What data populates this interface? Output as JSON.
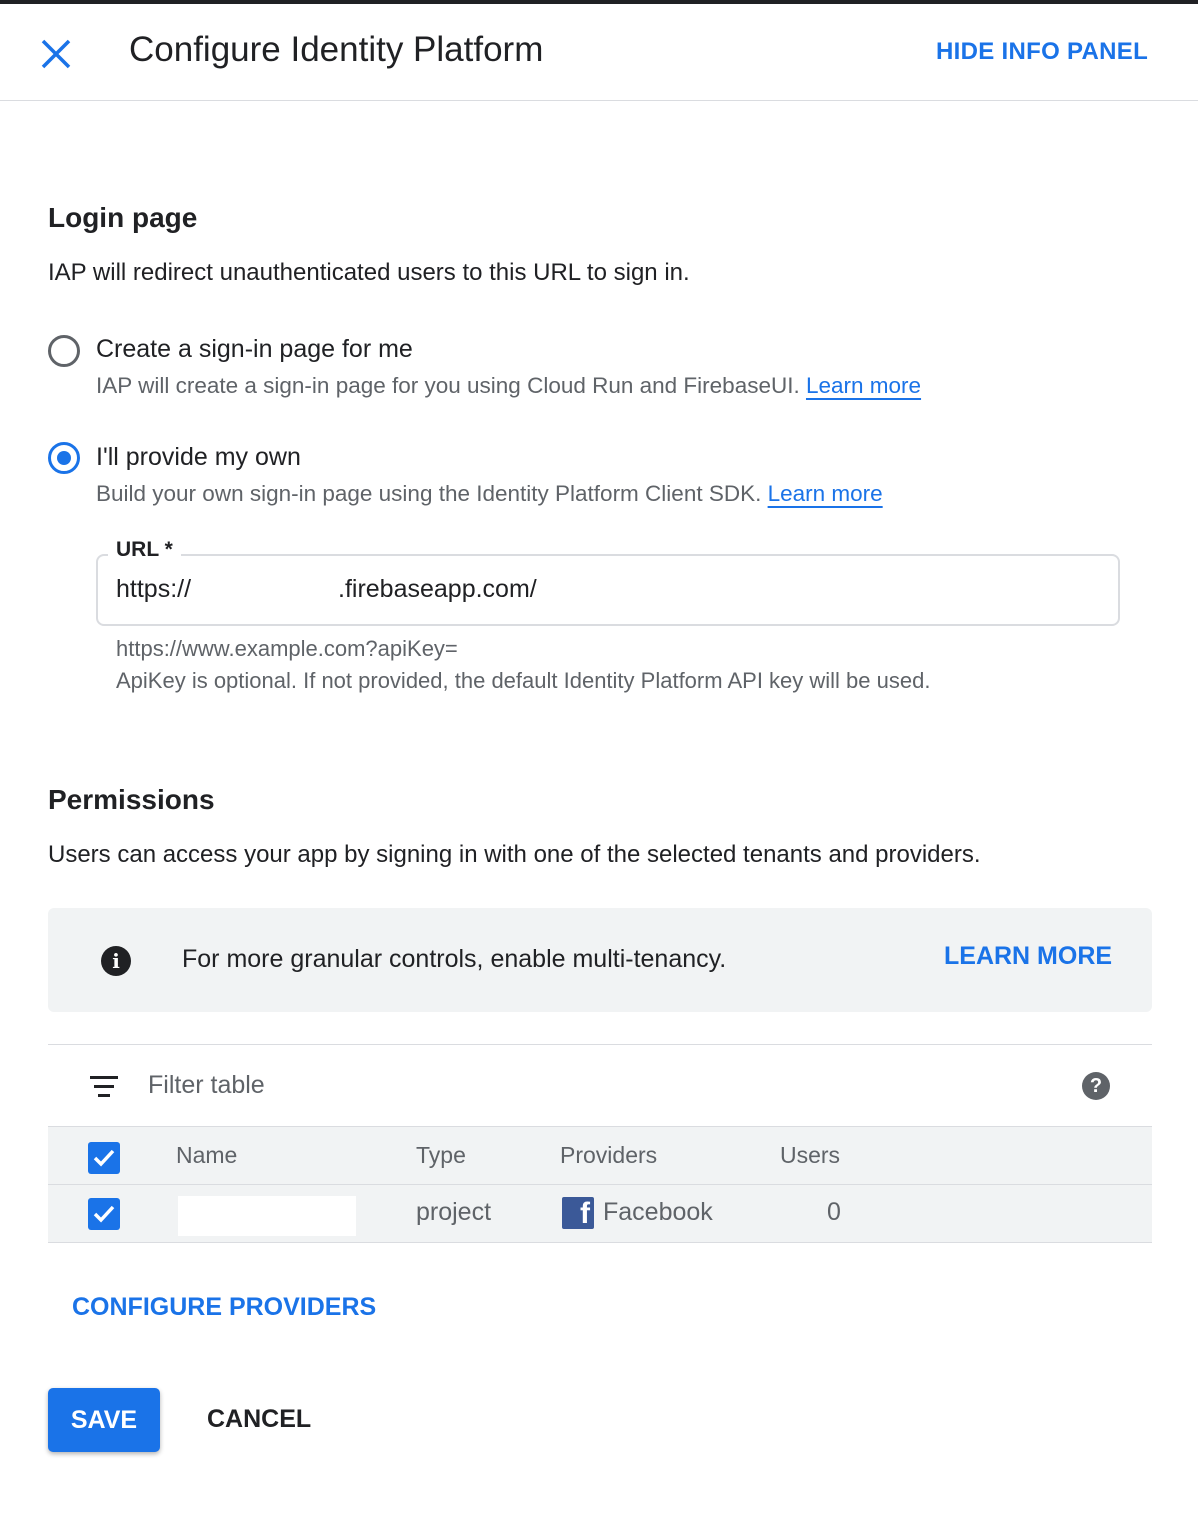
{
  "header": {
    "title": "Configure Identity Platform",
    "hide_panel_label": "HIDE INFO PANEL"
  },
  "login": {
    "heading": "Login page",
    "description": "IAP will redirect unauthenticated users to this URL to sign in.",
    "options": [
      {
        "label": "Create a sign-in page for me",
        "description": "IAP will create a sign-in page for you using Cloud Run and FirebaseUI.",
        "link": "Learn more",
        "selected": false
      },
      {
        "label": "I'll provide my own",
        "description": "Build your own sign-in page using the Identity Platform Client SDK.",
        "link": "Learn more",
        "selected": true
      }
    ],
    "url_field": {
      "label": "URL *",
      "value_prefix": "https://",
      "value_suffix": ".firebaseapp.com/",
      "hint_example": "https://www.example.com?apiKey=",
      "hint_note": "ApiKey is optional. If not provided, the default Identity Platform API key will be used."
    }
  },
  "permissions": {
    "heading": "Permissions",
    "description": "Users can access your app by signing in with one of the selected tenants and providers.",
    "banner": {
      "text": "For more granular controls, enable multi-tenancy.",
      "link": "LEARN MORE"
    },
    "table": {
      "filter_placeholder": "Filter table",
      "columns": [
        "Name",
        "Type",
        "Providers",
        "Users"
      ],
      "rows": [
        {
          "name": "",
          "type": "project",
          "provider": "Facebook",
          "users": "0",
          "checked": true
        }
      ]
    },
    "configure_providers_label": "CONFIGURE PROVIDERS"
  },
  "actions": {
    "save_label": "SAVE",
    "cancel_label": "CANCEL"
  },
  "colors": {
    "accent": "#1a73e8",
    "facebook": "#3b5998",
    "banner_bg": "#f1f3f4"
  }
}
